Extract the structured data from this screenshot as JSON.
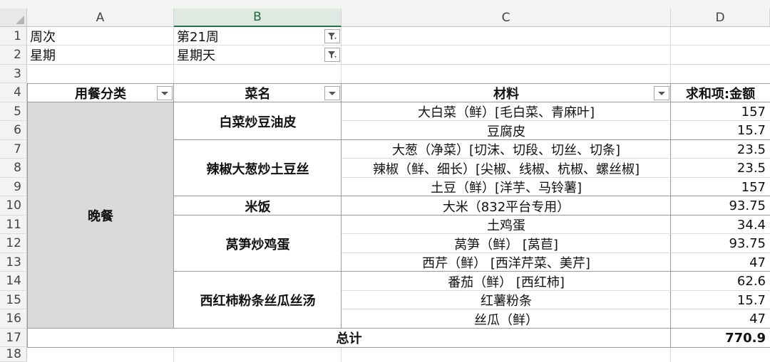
{
  "columns": [
    "A",
    "B",
    "C",
    "D"
  ],
  "rows": [
    "1",
    "2",
    "3",
    "4",
    "5",
    "6",
    "7",
    "8",
    "9",
    "10",
    "11",
    "12",
    "13",
    "14",
    "15",
    "16",
    "17",
    "18"
  ],
  "filters": {
    "week_label": "周次",
    "week_value": "第21周",
    "day_label": "星期",
    "day_value": "星期天"
  },
  "headers": {
    "category": "用餐分类",
    "dish": "菜名",
    "material": "材料",
    "amount": "求和项:金额"
  },
  "category_value": "晚餐",
  "dishes": [
    {
      "name": "白菜炒豆油皮"
    },
    {
      "name": "辣椒大葱炒土豆丝"
    },
    {
      "name": "米饭"
    },
    {
      "name": "莴笋炒鸡蛋"
    },
    {
      "name": "西红柿粉条丝瓜丝汤"
    }
  ],
  "items": [
    {
      "material": "大白菜（鲜）[毛白菜、青麻叶]",
      "amount": "157"
    },
    {
      "material": "豆腐皮",
      "amount": "15.7"
    },
    {
      "material": "大葱（净菜）[切沫、切段、切丝、切条]",
      "amount": "23.5"
    },
    {
      "material": "辣椒（鲜、细长）[尖椒、线椒、杭椒、螺丝椒]",
      "amount": "23.5"
    },
    {
      "material": "土豆（鲜）[洋芋、马铃薯]",
      "amount": "157"
    },
    {
      "material": "大米（832平台专用）",
      "amount": "93.75"
    },
    {
      "material": "土鸡蛋",
      "amount": "34.4"
    },
    {
      "material": "莴笋（鲜）  [莴苣]",
      "amount": "93.75"
    },
    {
      "material": "西芹（鲜）  [西洋芹菜、美芹]",
      "amount": "47"
    },
    {
      "material": "番茄（鲜）  [西红柿]",
      "amount": "62.6"
    },
    {
      "material": "红薯粉条",
      "amount": "15.7"
    },
    {
      "material": "丝瓜（鲜）",
      "amount": "47"
    }
  ],
  "total": {
    "label": "总计",
    "amount": "770.9"
  },
  "icons": {
    "filter": "filter-active-icon",
    "dropdown": "dropdown-arrow-icon",
    "select_all": "select-all-corner-icon"
  }
}
